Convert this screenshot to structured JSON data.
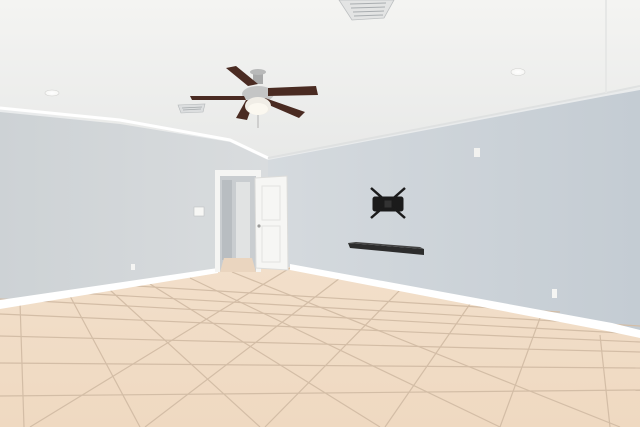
{
  "photo": {
    "subject": "empty-room-interior",
    "watermark_text": "",
    "colors": {
      "ceiling": "#f1f1ef",
      "wall_left": "#d3d7da",
      "wall_right": "#cfd6dc",
      "floor": "#f0dcc6",
      "grout": "#cdb7a0",
      "baseboard": "#ffffff",
      "fan_blade": "#4a2b22",
      "door": "#f4f4f2"
    }
  }
}
